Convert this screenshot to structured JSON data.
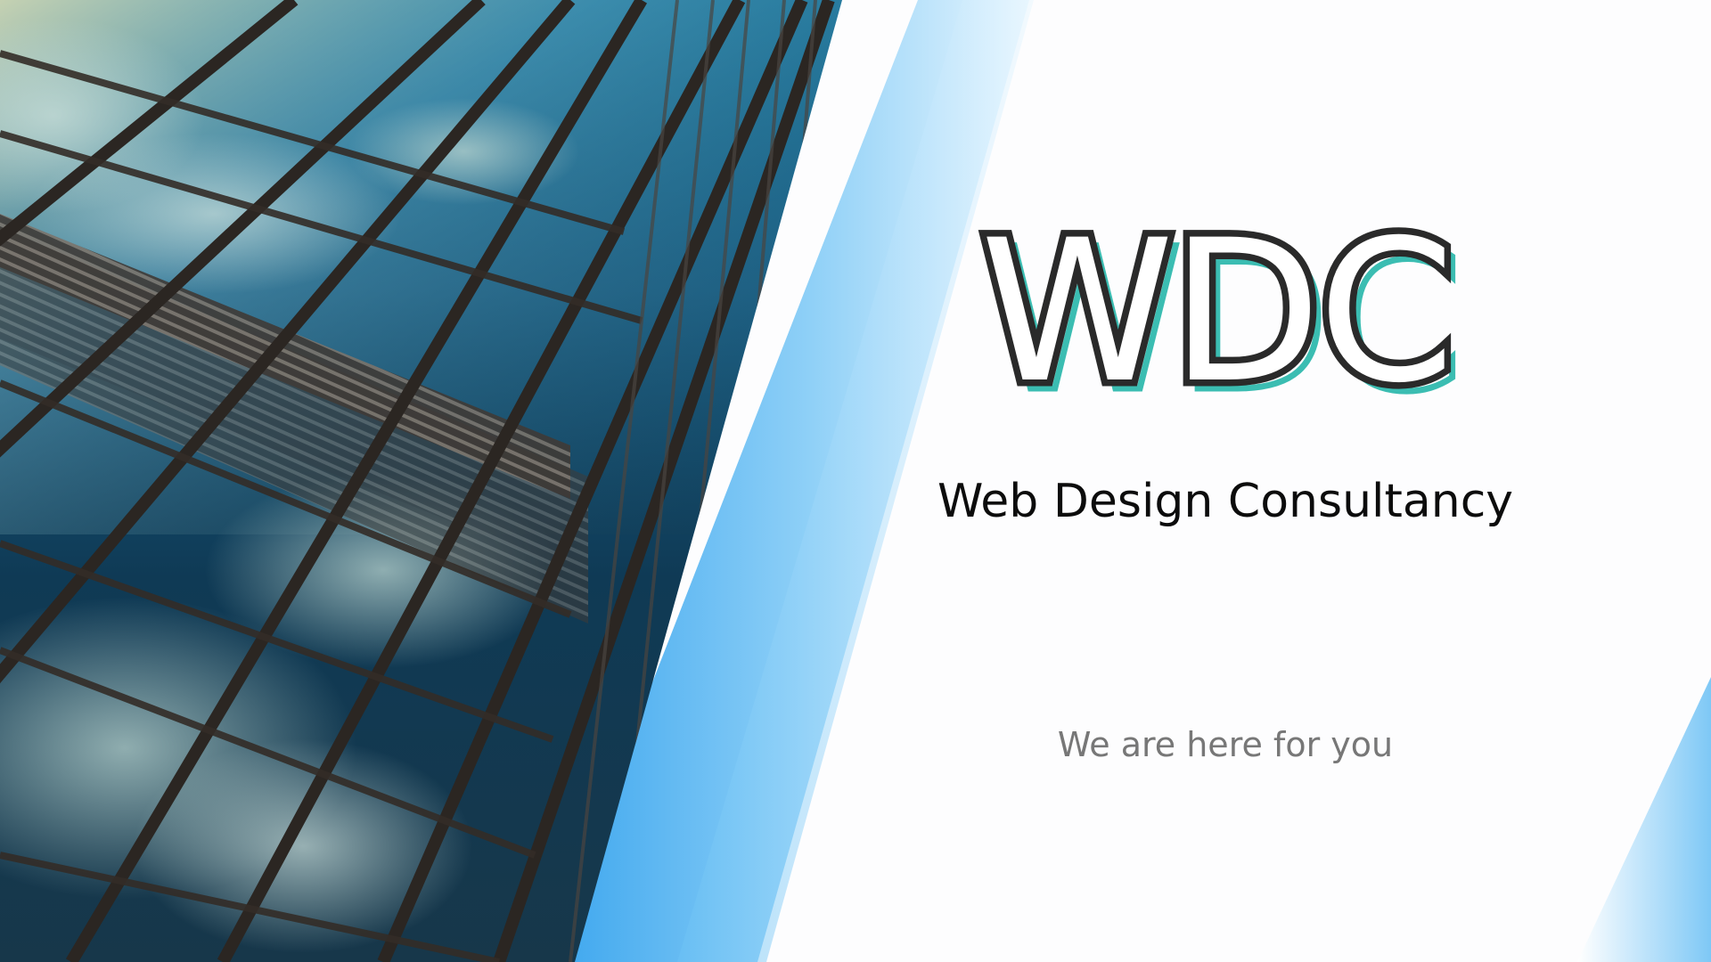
{
  "slide": {
    "logo_text": "WDC",
    "subtitle": "Web Design Consultancy",
    "tagline": "We are here for you"
  },
  "image": {
    "icon": "glass-skyscraper-photo"
  },
  "colors": {
    "logo_outline": "#2a2a2a",
    "logo_shadow": "#3bbdb2",
    "accent_blue": "#4fb3f0",
    "subtitle": "#0c0c0c",
    "tagline": "#777777"
  }
}
